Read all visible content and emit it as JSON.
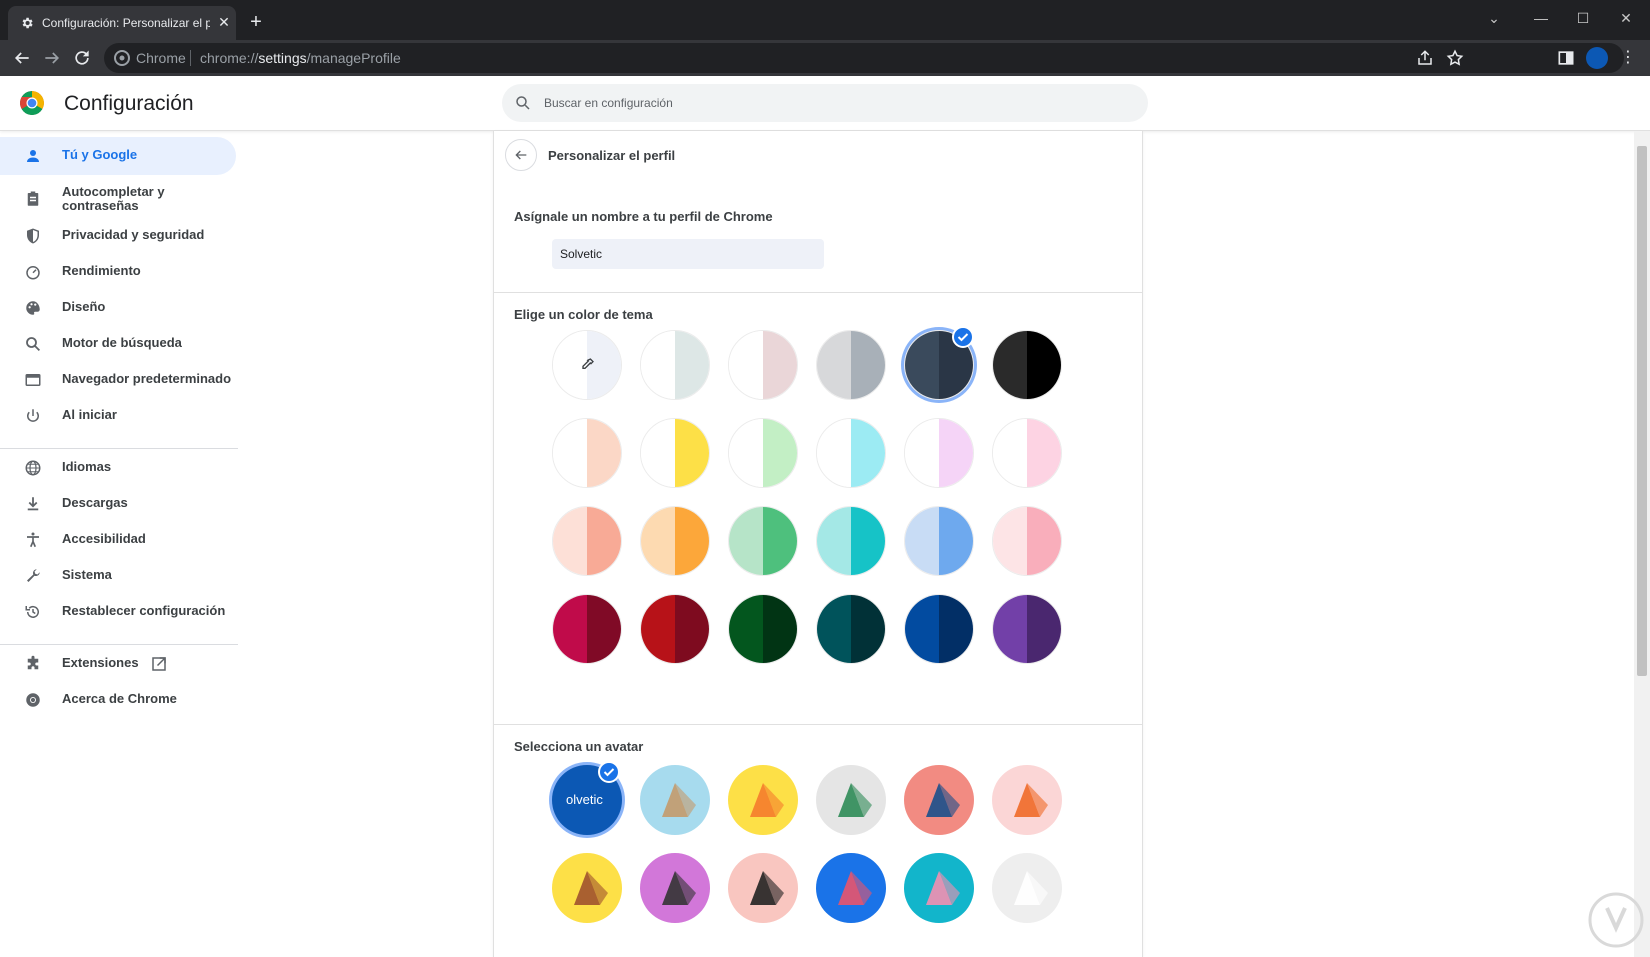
{
  "colors": {
    "accent": "#1a73e8",
    "active_nav_bg": "#e8f0fe",
    "chrome_dark": "#202124"
  },
  "browser": {
    "tab_title": "Configuración: Personalizar el pe",
    "tab_icon": "gear-icon",
    "omnibox_site": "Chrome",
    "omnibox_url_prefix": "chrome://",
    "omnibox_url_host": "settings",
    "omnibox_url_path": "/manageProfile"
  },
  "header": {
    "title": "Configuración",
    "search_placeholder": "Buscar en configuración"
  },
  "sidebar": {
    "items": [
      {
        "label": "Tú y Google",
        "icon": "person-icon",
        "active": true
      },
      {
        "label": "Autocompletar y contraseñas",
        "icon": "clipboard-icon"
      },
      {
        "label": "Privacidad y seguridad",
        "icon": "shield-icon"
      },
      {
        "label": "Rendimiento",
        "icon": "speedometer-icon"
      },
      {
        "label": "Diseño",
        "icon": "palette-icon"
      },
      {
        "label": "Motor de búsqueda",
        "icon": "search-icon"
      },
      {
        "label": "Navegador predeterminado",
        "icon": "browser-window-icon"
      },
      {
        "label": "Al iniciar",
        "icon": "power-icon"
      },
      {
        "label": "Idiomas",
        "icon": "globe-icon"
      },
      {
        "label": "Descargas",
        "icon": "download-icon"
      },
      {
        "label": "Accesibilidad",
        "icon": "accessibility-icon"
      },
      {
        "label": "Sistema",
        "icon": "wrench-icon"
      },
      {
        "label": "Restablecer configuración",
        "icon": "history-icon"
      },
      {
        "label": "Extensiones",
        "icon": "puzzle-icon"
      },
      {
        "label": "Acerca de Chrome",
        "icon": "chrome-icon"
      }
    ]
  },
  "main": {
    "subtitle": "Personalizar el perfil",
    "name_label": "Asígnale un nombre a tu perfil de Chrome",
    "name_value": "Solvetic",
    "theme_label": "Elige un color de tema",
    "avatar_label": "Selecciona un avatar",
    "selected_avatar_text": "olvetic",
    "theme_colors": [
      [
        "#ffffff",
        "#eef1f8"
      ],
      [
        "#ffffff",
        "#dde7e6"
      ],
      [
        "#ffffff",
        "#ead6d8"
      ],
      [
        "#d7d8da",
        "#a8b0b8"
      ],
      [
        "#3a4a5c",
        "#2a3646"
      ],
      [
        "#2a2a2a",
        "#000000"
      ],
      [
        "#ffffff",
        "#fbd7c6"
      ],
      [
        "#ffffff",
        "#fde047"
      ],
      [
        "#ffffff",
        "#c3efc5"
      ],
      [
        "#ffffff",
        "#9cebf3"
      ],
      [
        "#ffffff",
        "#f5d4f7"
      ],
      [
        "#ffffff",
        "#fdd3e3"
      ],
      [
        "#fde0d7",
        "#f8aa96"
      ],
      [
        "#fddab1",
        "#fca73a"
      ],
      [
        "#b6e4c8",
        "#4ec07d"
      ],
      [
        "#a4e8e6",
        "#16c3c7"
      ],
      [
        "#c8dcf5",
        "#6ea9ee"
      ],
      [
        "#fde4e6",
        "#f9aebb"
      ],
      [
        "#c00b4a",
        "#800a26"
      ],
      [
        "#b71218",
        "#7e0b1f"
      ],
      [
        "#03561e",
        "#013414"
      ],
      [
        "#00535b",
        "#013137"
      ],
      [
        "#024ba0",
        "#022f66"
      ],
      [
        "#7240a8",
        "#4a276f"
      ]
    ],
    "selected_theme_index": 4,
    "avatars": [
      {
        "icon": "solvetic-avatar-icon",
        "bg": "#0c58b4"
      },
      {
        "icon": "origami-cat-avatar-icon",
        "bg": "#a7dbee"
      },
      {
        "icon": "origami-fox-avatar-icon",
        "bg": "#fde047"
      },
      {
        "icon": "origami-dragon-avatar-icon",
        "bg": "#e5e5e5"
      },
      {
        "icon": "origami-elephant-avatar-icon",
        "bg": "#f28b82"
      },
      {
        "icon": "origami-fox2-avatar-icon",
        "bg": "#fbd6d6"
      },
      {
        "icon": "origami-monkey-avatar-icon",
        "bg": "#fde047"
      },
      {
        "icon": "origami-panda-avatar-icon",
        "bg": "#d277d9"
      },
      {
        "icon": "origami-penguin-avatar-icon",
        "bg": "#f9c6c0"
      },
      {
        "icon": "origami-butterfly-avatar-icon",
        "bg": "#1a73e8"
      },
      {
        "icon": "origami-rabbit-avatar-icon",
        "bg": "#12b5cb"
      },
      {
        "icon": "origami-unicorn-avatar-icon",
        "bg": "#eeeeee"
      }
    ]
  }
}
